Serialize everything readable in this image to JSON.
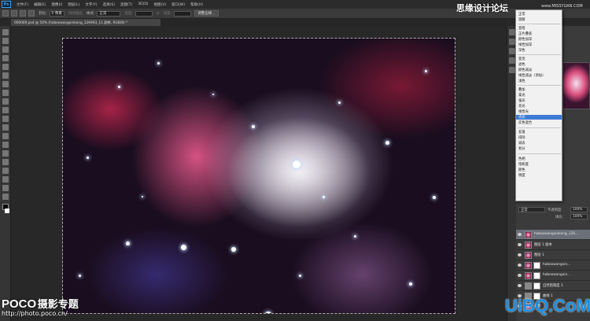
{
  "menubar": {
    "logo": "Ps",
    "items": [
      "文件(F)",
      "编辑(E)",
      "图像(I)",
      "图层(L)",
      "文字(Y)",
      "选择(S)",
      "滤镜(T)",
      "3D(D)",
      "视图(V)",
      "窗口(W)",
      "帮助(H)"
    ]
  },
  "options": {
    "feather_label": "羽化:",
    "feather_value": "0 像素",
    "antialias_label": "消除锯齿",
    "style_label": "样式:",
    "style_value": "正常",
    "width_label": "宽度:",
    "height_label": "高度:",
    "refine_edge": "调整边缘..."
  },
  "document": {
    "tab_title": "000009.psd @ 50% (haboxwangxinkong_126903_11 副本, RGB/8) *"
  },
  "watermarks": {
    "poco_logo": "POCO",
    "poco_title": "摄影专题",
    "poco_url": "http://photo.poco.cn/",
    "top_main": "思缘设计论坛",
    "top_url": "www.MISSYUAN.COM",
    "uibq": "UiBQ.CoM"
  },
  "blend_menu": {
    "groups": [
      [
        "正常",
        "溶解"
      ],
      [
        "变暗",
        "正片叠底",
        "颜色加深",
        "线性加深",
        "深色"
      ],
      [
        "变亮",
        "滤色",
        "颜色减淡",
        "线性减淡（添加）",
        "浅色"
      ],
      [
        "叠加",
        "柔光",
        "强光",
        "亮光",
        "线性光",
        "点光",
        "实色混合"
      ],
      [
        "差值",
        "排除",
        "减去",
        "划分"
      ],
      [
        "色相",
        "饱和度",
        "颜色",
        "明度"
      ]
    ],
    "selected": "点光"
  },
  "layers_panel": {
    "mode_value": "正常",
    "opacity_label": "不透明度:",
    "opacity_value": "100%",
    "fill_label": "填充:",
    "fill_value": "100%",
    "layers": [
      {
        "name": "haboxwangxinkong_126...",
        "selected": true,
        "mask": false
      },
      {
        "name": "图层 1 副本",
        "selected": false,
        "mask": false
      },
      {
        "name": "图层 1",
        "selected": false,
        "mask": false
      },
      {
        "name": "haboxwangxin...",
        "selected": false,
        "mask": true
      },
      {
        "name": "haboxwangxin...",
        "selected": false,
        "mask": true
      },
      {
        "name": "自然饱和度 1",
        "selected": false,
        "mask": true
      },
      {
        "name": "曲线 1",
        "selected": false,
        "mask": true
      },
      {
        "name": "背景",
        "selected": false,
        "mask": false
      }
    ]
  }
}
